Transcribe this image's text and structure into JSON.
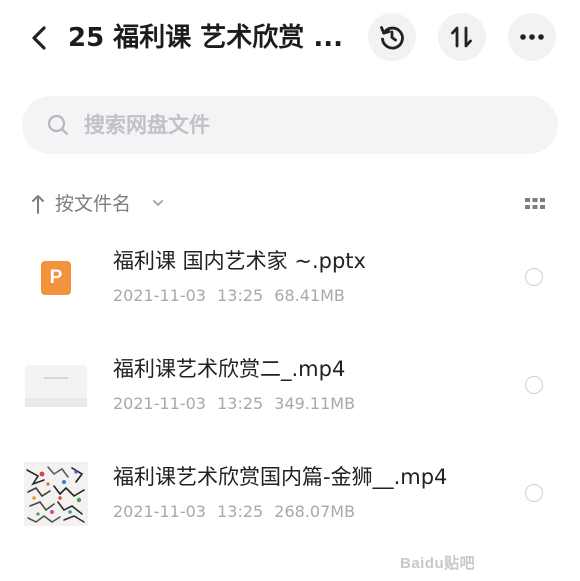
{
  "header": {
    "title": "25 福利课 艺术欣赏 ...",
    "buttons": {
      "back": "chevron-left-icon",
      "history": "history-icon",
      "sort": "sort-icon",
      "more": "more-horizontal-icon"
    }
  },
  "search": {
    "placeholder": "搜索网盘文件",
    "value": ""
  },
  "sort_bar": {
    "label": "按文件名"
  },
  "files": [
    {
      "name": "福利课 国内艺术家 ~.pptx",
      "date": "2021-11-03",
      "time": "13:25",
      "size": "68.41MB",
      "badge": "P",
      "type": "pptx"
    },
    {
      "name": "福利课艺术欣赏二_.mp4",
      "date": "2021-11-03",
      "time": "13:25",
      "size": "349.11MB",
      "type": "video"
    },
    {
      "name": "福利课艺术欣赏国内篇-金狮__.mp4",
      "date": "2021-11-03",
      "time": "13:25",
      "size": "268.07MB",
      "type": "video"
    }
  ],
  "watermark": "Baidu贴吧",
  "colors": {
    "pptx_accent": "#f5923e",
    "button_bg": "#f2f2f4",
    "search_bg": "#f4f4f6",
    "meta_text": "#a8a8ad"
  }
}
